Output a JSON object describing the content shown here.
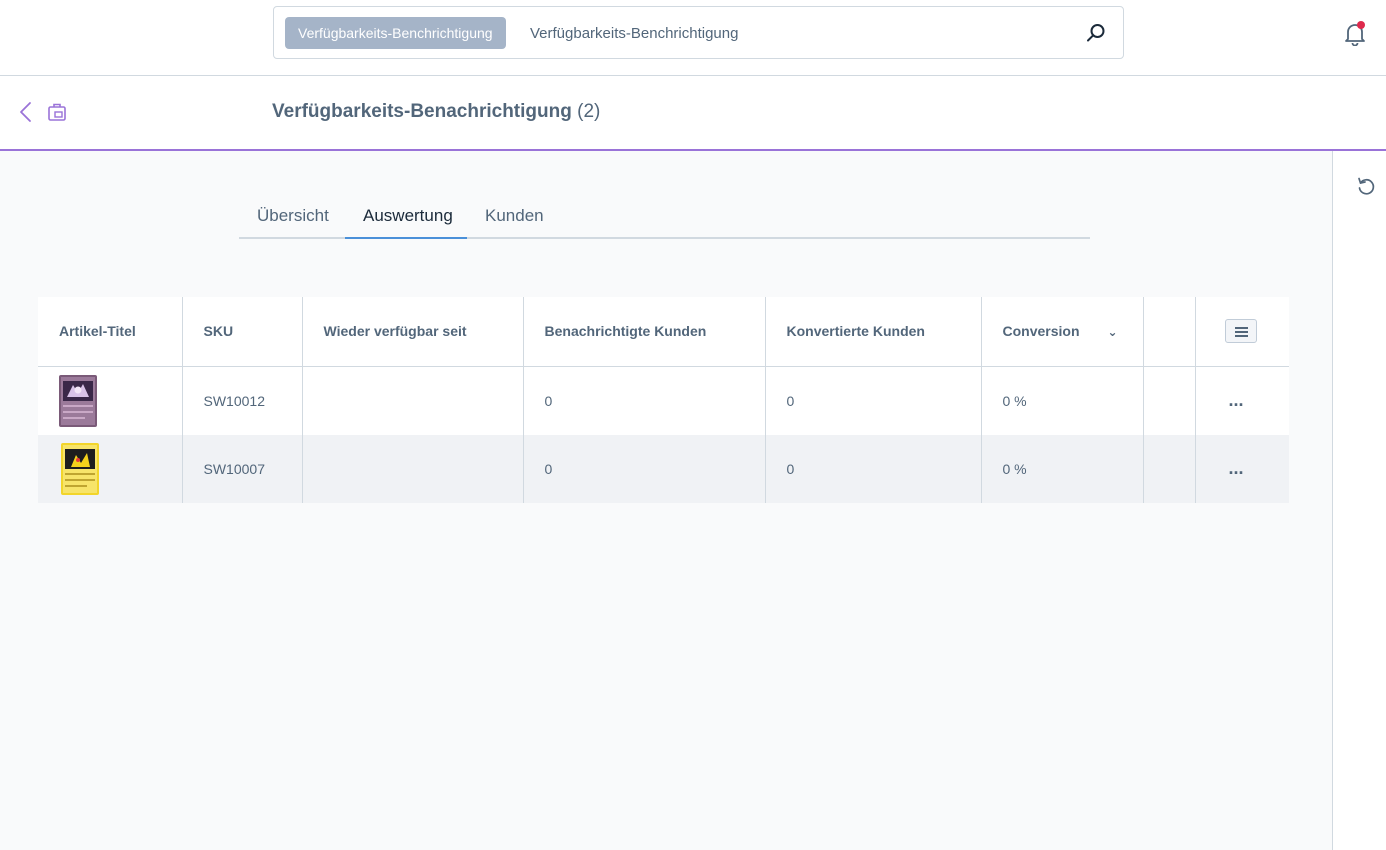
{
  "search": {
    "chip_label": "Verfügbarkeits-Benchrichtigung",
    "placeholder": "Verfügbarkeits-Benchrichtigung",
    "icon": "search-icon"
  },
  "notifications": {
    "icon": "bell-icon",
    "has_unread": true
  },
  "header": {
    "title": "Verfügbarkeits-Benachrichtigung",
    "count": "(2)",
    "back_icon": "chevron-left-icon",
    "module_icon": "briefcase-icon"
  },
  "tabs": [
    {
      "label": "Übersicht",
      "active": false
    },
    {
      "label": "Auswertung",
      "active": true
    },
    {
      "label": "Kunden",
      "active": false
    }
  ],
  "table": {
    "columns": [
      "Artikel-Titel",
      "SKU",
      "Wieder verfügbar seit",
      "Benachrichtigte Kunden",
      "Konvertierte Kunden",
      "Conversion"
    ],
    "rows": [
      {
        "image": "trading-card-purple",
        "sku": "SW10012",
        "available_since": "",
        "notified": "0",
        "converted": "0",
        "conversion": "0 %",
        "actions": "..."
      },
      {
        "image": "trading-card-yellow",
        "sku": "SW10007",
        "available_since": "",
        "notified": "0",
        "converted": "0",
        "conversion": "0 %",
        "actions": "..."
      }
    ]
  },
  "sidebar": {
    "reset_icon": "refresh-icon"
  },
  "colors": {
    "accent_purple": "#9a73d8",
    "active_tab": "#4a90d9",
    "notification_dot": "#de294c"
  }
}
